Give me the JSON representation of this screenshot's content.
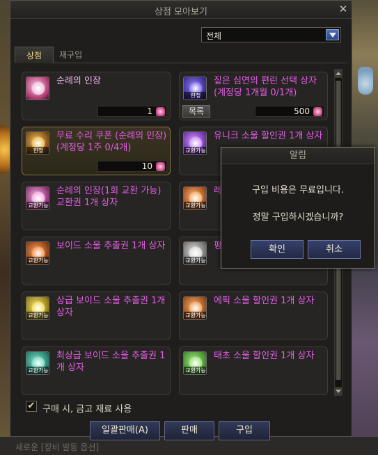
{
  "window": {
    "title": "상점 모아보기",
    "close_glyph": "✕"
  },
  "filter": {
    "selected": "전체"
  },
  "tabs": [
    {
      "label": "상점"
    },
    {
      "label": "재구입"
    }
  ],
  "items": [
    {
      "name": "순례의 인장",
      "price": "1",
      "color": "#e8b7e8",
      "icon": "seal-icon",
      "icon_tag": ""
    },
    {
      "name": "짙은 심연의 편린 선택 상자 (계정당 1개월 0/1개)",
      "price": "500",
      "color": "#e65ce8",
      "icon": "abyss-box-icon",
      "icon_tag": "한정",
      "list_label": "목록"
    },
    {
      "name": "무료 수리 쿠폰 (순례의 인장) (계정당 1주 0/4개)",
      "price": "10",
      "color": "#e65ce8",
      "icon": "repair-coupon-icon",
      "icon_tag": "한정"
    },
    {
      "name": "유니크 소울 할인권 1개 상자",
      "price": "",
      "color": "#e65ce8",
      "icon": "unique-soul-icon",
      "icon_tag": "교환가능"
    },
    {
      "name": "순례의 인장(1회 교환 가능) 교환권 1개 상자",
      "price": "",
      "color": "#e65ce8",
      "icon": "seal-ticket-icon",
      "icon_tag": "교환가능"
    },
    {
      "name": "레",
      "price": "",
      "color": "#e65ce8",
      "icon": "legend-soul-icon",
      "icon_tag": "교환가능"
    },
    {
      "name": "보이드 소울 추출권 1개 상자",
      "price": "",
      "color": "#e65ce8",
      "icon": "void-soul-icon",
      "icon_tag": "교환가능"
    },
    {
      "name": "평",
      "price": "",
      "color": "#e65ce8",
      "icon": "soul-icon",
      "icon_tag": "교환가능"
    },
    {
      "name": "상급 보이드 소울 추출권 1개 상자",
      "price": "",
      "color": "#e65ce8",
      "icon": "high-void-soul-icon",
      "icon_tag": "교환가능"
    },
    {
      "name": "에픽 소울 할인권 1개 상자",
      "price": "",
      "color": "#e65ce8",
      "icon": "epic-soul-icon",
      "icon_tag": "교환가능"
    },
    {
      "name": "최상급 보이드 소울 추출권 1개 상자",
      "price": "",
      "color": "#e65ce8",
      "icon": "top-void-soul-icon",
      "icon_tag": "교환가능"
    },
    {
      "name": "태초 소울 할인권 1개 상자",
      "price": "",
      "color": "#e65ce8",
      "icon": "primal-soul-icon",
      "icon_tag": "교환가능"
    }
  ],
  "checkbox": {
    "label": "구매 시, 금고 재료 사용",
    "checked": true
  },
  "buttons": {
    "bulk_sell": "일괄판매(A)",
    "sell": "판매",
    "buy": "구입"
  },
  "dialog": {
    "title": "알림",
    "line1": "구입 비용은 무료입니다.",
    "line2": "정말 구입하시겠습니까?",
    "confirm": "확인",
    "cancel": "취소"
  },
  "background": {
    "bottom_text": "새로운 [장비 발동 옵션]"
  },
  "colors": {
    "accent_gold": "#f0d590",
    "item_purple": "#e65ce8",
    "button_blue": "#333a58"
  }
}
